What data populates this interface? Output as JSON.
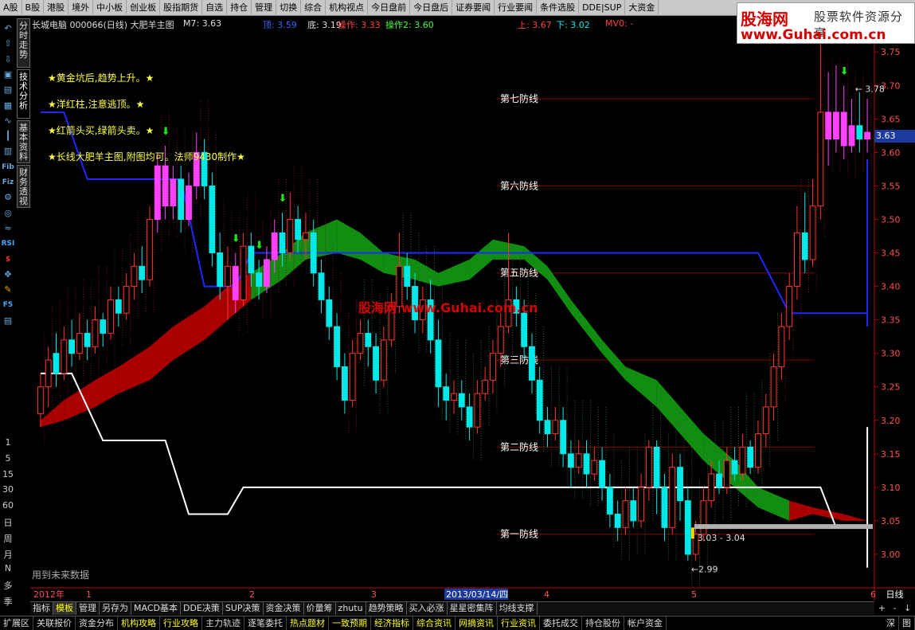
{
  "top_menu": [
    "A股",
    "B股",
    "港股",
    "境外",
    "中小板",
    "创业板",
    "股指期货",
    "自选",
    "持仓",
    "管理",
    "切换",
    "综合",
    "机构视点",
    "今日盘前",
    "今日盘后",
    "证券要闻",
    "行业要闻",
    "条件选股",
    "DDE|SUP",
    "大资金"
  ],
  "logo": {
    "name": "股海网",
    "slogan": "股票软件资源分享",
    "url": "www.Guhai.com.cn"
  },
  "info": {
    "stock": "长城电脑 000066(日线) 大肥羊主图",
    "m7": "M7: 3.63",
    "ding": "顶: 3.59",
    "di": "底: 3.19",
    "op": "操作: 3.33",
    "op2": "操作2: 3.60",
    "up": "上: 3.67",
    "down": "下: 3.02",
    "mw": "MV0: -"
  },
  "annotations": [
    "★黄金坑后,趋势上升。★",
    "★洋红柱,注意逃顶。★",
    "★红箭头买,绿箭头卖。★",
    "★长线大肥羊主图,附图均可。法师9430制作★"
  ],
  "defense_lines": [
    "第七防线",
    "第六防线",
    "第五防线",
    "第三防线",
    "第二防线",
    "第一防线"
  ],
  "watermark": "股海网 www.Guhai.com.cn",
  "no_data": "用到未来数据",
  "vertical_tabs": [
    "分时走势",
    "技术分析",
    "基本资料",
    "财务透视"
  ],
  "left_icons": [
    "undo-icon",
    "arrow-up-icon",
    "arrow-down-icon",
    "square-icon",
    "k-chart-icon",
    "grid-icon",
    "line-icon",
    "candle-icon",
    "bar-icon",
    "fib-icon",
    "fiz-icon",
    "gear-icon",
    "sphere-icon",
    "wave-icon",
    "rsi-icon",
    "dollar-icon",
    "move-icon",
    "pen-icon",
    "f5-icon",
    "page-icon"
  ],
  "left_icon_labels": {
    "rsi": "RSI",
    "f5": "F5",
    "fib": "Fib",
    "fiz": "Fiz",
    "dollar": "$"
  },
  "periods": [
    "1",
    "5",
    "15",
    "30",
    "60",
    "日",
    "周",
    "月",
    "N",
    "多",
    "季"
  ],
  "price_tag": "3.63",
  "high_label": "3.78",
  "low_label": "2.99",
  "range_label": "3.03 - 3.04",
  "date_labels": [
    "2012年",
    "1",
    "2",
    "3",
    "2013/03/14/四",
    "4",
    "5",
    "6"
  ],
  "y_axis_tab": "日线",
  "bottom_tabs": [
    "指标",
    "模板",
    "管理",
    "另存为",
    "MACD基本",
    "DDE决策",
    "SUP决策",
    "资金决策",
    "价量筹",
    "zhutu",
    "趋势策略",
    "买入必涨",
    "星星密集阵",
    "均线支撑"
  ],
  "bottom_tabs_active": "模板",
  "bottom_bar": [
    {
      "label": "扩展区",
      "color": "#dddddd"
    },
    {
      "label": "关联报价",
      "color": "#dddddd"
    },
    {
      "label": "资金分布",
      "color": "#dddddd"
    },
    {
      "label": "机构攻略",
      "color": "#ffff00"
    },
    {
      "label": "行业攻略",
      "color": "#ffff00"
    },
    {
      "label": "主力轨迹",
      "color": "#dddddd"
    },
    {
      "label": "逐笔委托",
      "color": "#dddddd"
    },
    {
      "label": "热点题材",
      "color": "#ffff00"
    },
    {
      "label": "一致预期",
      "color": "#ffff00"
    },
    {
      "label": "经济指标",
      "color": "#ffff00"
    },
    {
      "label": "综合资讯",
      "color": "#ffff00"
    },
    {
      "label": "网摘资讯",
      "color": "#ffff00"
    },
    {
      "label": "行业资讯",
      "color": "#ffff00"
    },
    {
      "label": "委托成交",
      "color": "#dddddd"
    },
    {
      "label": "持仓股份",
      "color": "#dddddd"
    },
    {
      "label": "帐户资金",
      "color": "#dddddd"
    }
  ],
  "right_nav": [
    "深",
    "图"
  ],
  "colors": {
    "up": "#ff3232",
    "down": "#00e8e8",
    "magenta": "#ff40ff",
    "band_red": "#b40000",
    "band_green": "#129612",
    "blue_line": "#1e28ff",
    "white_line": "#ffffff",
    "grid_red": "#800000"
  },
  "chart_data": {
    "type": "candlestick",
    "ylim": [
      2.95,
      3.78
    ],
    "y_ticks": [
      3.0,
      3.05,
      3.1,
      3.15,
      3.2,
      3.25,
      3.3,
      3.35,
      3.4,
      3.45,
      3.5,
      3.55,
      3.6,
      3.65,
      3.7,
      3.75
    ],
    "candles": [
      [
        3.21,
        3.25,
        3.19,
        3.27
      ],
      [
        3.25,
        3.29,
        3.22,
        3.31
      ],
      [
        3.3,
        3.27,
        3.25,
        3.33
      ],
      [
        3.27,
        3.32,
        3.26,
        3.34
      ],
      [
        3.32,
        3.3,
        3.28,
        3.35
      ],
      [
        3.3,
        3.33,
        3.29,
        3.36
      ],
      [
        3.33,
        3.31,
        3.29,
        3.35
      ],
      [
        3.31,
        3.35,
        3.3,
        3.37
      ],
      [
        3.35,
        3.33,
        3.31,
        3.36
      ],
      [
        3.33,
        3.38,
        3.32,
        3.4
      ],
      [
        3.38,
        3.36,
        3.34,
        3.4
      ],
      [
        3.36,
        3.4,
        3.35,
        3.42
      ],
      [
        3.4,
        3.43,
        3.38,
        3.45
      ],
      [
        3.43,
        3.41,
        3.39,
        3.46
      ],
      [
        3.41,
        3.5,
        3.4,
        3.52
      ],
      [
        3.5,
        3.58,
        3.48,
        3.6
      ],
      [
        3.58,
        3.52,
        3.5,
        3.61
      ],
      [
        3.52,
        3.56,
        3.5,
        3.58
      ],
      [
        3.56,
        3.5,
        3.48,
        3.58
      ],
      [
        3.5,
        3.55,
        3.49,
        3.57
      ],
      [
        3.55,
        3.6,
        3.53,
        3.63
      ],
      [
        3.6,
        3.55,
        3.53,
        3.62
      ],
      [
        3.55,
        3.45,
        3.43,
        3.57
      ],
      [
        3.45,
        3.4,
        3.38,
        3.48
      ],
      [
        3.4,
        3.43,
        3.35,
        3.46
      ],
      [
        3.43,
        3.38,
        3.36,
        3.45
      ],
      [
        3.38,
        3.46,
        3.37,
        3.48
      ],
      [
        3.46,
        3.42,
        3.4,
        3.48
      ],
      [
        3.42,
        3.4,
        3.38,
        3.44
      ],
      [
        3.4,
        3.44,
        3.39,
        3.46
      ],
      [
        3.44,
        3.48,
        3.42,
        3.5
      ],
      [
        3.48,
        3.45,
        3.43,
        3.51
      ],
      [
        3.45,
        3.5,
        3.44,
        3.54
      ],
      [
        3.5,
        3.47,
        3.45,
        3.52
      ],
      [
        3.47,
        3.48,
        3.44,
        3.51
      ],
      [
        3.48,
        3.42,
        3.4,
        3.5
      ],
      [
        3.42,
        3.38,
        3.36,
        3.44
      ],
      [
        3.38,
        3.34,
        3.32,
        3.4
      ],
      [
        3.34,
        3.28,
        3.26,
        3.36
      ],
      [
        3.28,
        3.23,
        3.21,
        3.3
      ],
      [
        3.23,
        3.3,
        3.22,
        3.32
      ],
      [
        3.3,
        3.33,
        3.29,
        3.35
      ],
      [
        3.33,
        3.31,
        3.28,
        3.35
      ],
      [
        3.31,
        3.26,
        3.24,
        3.33
      ],
      [
        3.26,
        3.32,
        3.25,
        3.34
      ],
      [
        3.32,
        3.37,
        3.31,
        3.39
      ],
      [
        3.37,
        3.43,
        3.36,
        3.48
      ],
      [
        3.43,
        3.4,
        3.38,
        3.45
      ],
      [
        3.4,
        3.35,
        3.33,
        3.42
      ],
      [
        3.35,
        3.38,
        3.33,
        3.4
      ],
      [
        3.38,
        3.32,
        3.3,
        3.41
      ],
      [
        3.32,
        3.25,
        3.22,
        3.35
      ],
      [
        3.25,
        3.23,
        3.2,
        3.27
      ],
      [
        3.23,
        3.24,
        3.21,
        3.26
      ],
      [
        3.24,
        3.22,
        3.2,
        3.26
      ],
      [
        3.22,
        3.19,
        3.17,
        3.24
      ],
      [
        3.19,
        3.24,
        3.18,
        3.26
      ],
      [
        3.24,
        3.26,
        3.23,
        3.28
      ],
      [
        3.26,
        3.3,
        3.24,
        3.32
      ],
      [
        3.3,
        3.34,
        3.28,
        3.36
      ],
      [
        3.34,
        3.38,
        3.33,
        3.48
      ],
      [
        3.38,
        3.36,
        3.34,
        3.4
      ],
      [
        3.36,
        3.31,
        3.29,
        3.38
      ],
      [
        3.31,
        3.26,
        3.24,
        3.33
      ],
      [
        3.26,
        3.2,
        3.18,
        3.28
      ],
      [
        3.2,
        3.18,
        3.16,
        3.22
      ],
      [
        3.18,
        3.2,
        3.17,
        3.22
      ],
      [
        3.2,
        3.15,
        3.13,
        3.22
      ],
      [
        3.15,
        3.13,
        3.1,
        3.17
      ],
      [
        3.13,
        3.15,
        3.12,
        3.17
      ],
      [
        3.15,
        3.12,
        3.1,
        3.17
      ],
      [
        3.12,
        3.14,
        3.11,
        3.16
      ],
      [
        3.14,
        3.1,
        3.08,
        3.16
      ],
      [
        3.1,
        3.06,
        3.04,
        3.12
      ],
      [
        3.06,
        3.04,
        3.02,
        3.08
      ],
      [
        3.04,
        3.08,
        3.03,
        3.1
      ],
      [
        3.08,
        3.05,
        3.04,
        3.1
      ],
      [
        3.05,
        3.1,
        3.04,
        3.12
      ],
      [
        3.1,
        3.16,
        3.08,
        3.17
      ],
      [
        3.16,
        3.1,
        3.06,
        3.17
      ],
      [
        3.1,
        3.04,
        3.02,
        3.12
      ],
      [
        3.04,
        3.13,
        3.03,
        3.15
      ],
      [
        3.13,
        3.08,
        3.05,
        3.15
      ],
      [
        3.08,
        3.0,
        2.99,
        3.1
      ],
      [
        3.0,
        3.03,
        2.99,
        3.05
      ],
      [
        3.03,
        3.08,
        3.02,
        3.1
      ],
      [
        3.08,
        3.12,
        3.07,
        3.14
      ],
      [
        3.12,
        3.1,
        3.09,
        3.14
      ],
      [
        3.1,
        3.14,
        3.09,
        3.16
      ],
      [
        3.14,
        3.12,
        3.11,
        3.16
      ],
      [
        3.12,
        3.16,
        3.11,
        3.18
      ],
      [
        3.16,
        3.13,
        3.12,
        3.17
      ],
      [
        3.13,
        3.18,
        3.12,
        3.2
      ],
      [
        3.18,
        3.22,
        3.16,
        3.24
      ],
      [
        3.22,
        3.28,
        3.2,
        3.3
      ],
      [
        3.28,
        3.34,
        3.26,
        3.36
      ],
      [
        3.34,
        3.4,
        3.32,
        3.42
      ],
      [
        3.4,
        3.48,
        3.38,
        3.52
      ],
      [
        3.48,
        3.44,
        3.42,
        3.54
      ],
      [
        3.44,
        3.52,
        3.43,
        3.56
      ],
      [
        3.52,
        3.66,
        3.5,
        3.78
      ],
      [
        3.66,
        3.62,
        3.58,
        3.72
      ],
      [
        3.62,
        3.66,
        3.6,
        3.73
      ],
      [
        3.66,
        3.61,
        3.59,
        3.7
      ],
      [
        3.61,
        3.64,
        3.6,
        3.68
      ],
      [
        3.64,
        3.62,
        3.6,
        3.69
      ],
      [
        3.62,
        3.63,
        3.6,
        3.68
      ]
    ],
    "magenta_bars": [
      15,
      16,
      17,
      19,
      20,
      25,
      29,
      30,
      101,
      102,
      103,
      104,
      106
    ],
    "blue_line": [
      [
        0,
        3.66
      ],
      [
        3,
        3.66
      ],
      [
        6,
        3.56
      ],
      [
        18,
        3.56
      ],
      [
        21,
        3.4
      ],
      [
        25,
        3.4
      ],
      [
        27,
        3.45
      ],
      [
        92,
        3.45
      ],
      [
        96,
        3.36
      ],
      [
        113,
        3.36
      ],
      [
        117,
        3.34
      ],
      [
        121,
        3.34
      ],
      [
        125,
        3.4
      ],
      [
        128,
        3.59
      ],
      [
        140,
        3.59
      ]
    ],
    "white_line": [
      [
        0,
        3.27
      ],
      [
        4,
        3.27
      ],
      [
        8,
        3.17
      ],
      [
        16,
        3.17
      ],
      [
        19,
        3.06
      ],
      [
        24,
        3.06
      ],
      [
        26,
        3.1
      ],
      [
        100,
        3.1
      ],
      [
        102,
        3.04
      ],
      [
        112,
        3.04
      ],
      [
        116,
        3.0
      ],
      [
        118,
        2.98
      ],
      [
        125,
        2.98
      ],
      [
        127,
        3.0
      ],
      [
        129,
        3.0
      ],
      [
        131,
        3.19
      ],
      [
        137,
        3.19
      ]
    ],
    "band_red_top": [
      3.2,
      3.23,
      3.26,
      3.28,
      3.31,
      3.34,
      3.37,
      3.4,
      3.42,
      3.45,
      3.48,
      3.5,
      3.48,
      3.45,
      3.44,
      3.42,
      3.44,
      3.47,
      3.46,
      3.43,
      3.38,
      3.32,
      3.28,
      3.26,
      3.22,
      3.18,
      3.14,
      3.1,
      3.08,
      3.07,
      3.06,
      3.05
    ],
    "band_red_bottom": [
      3.19,
      3.2,
      3.22,
      3.24,
      3.26,
      3.29,
      3.32,
      3.35,
      3.38,
      3.41,
      3.44,
      3.45,
      3.44,
      3.42,
      3.41,
      3.4,
      3.41,
      3.44,
      3.44,
      3.41,
      3.36,
      3.3,
      3.26,
      3.22,
      3.18,
      3.14,
      3.1,
      3.07,
      3.05,
      3.06,
      3.05,
      3.05
    ],
    "defense_levels": [
      3.68,
      3.55,
      3.42,
      3.29,
      3.16,
      3.03
    ],
    "high_index": 103,
    "low_index": 83
  }
}
